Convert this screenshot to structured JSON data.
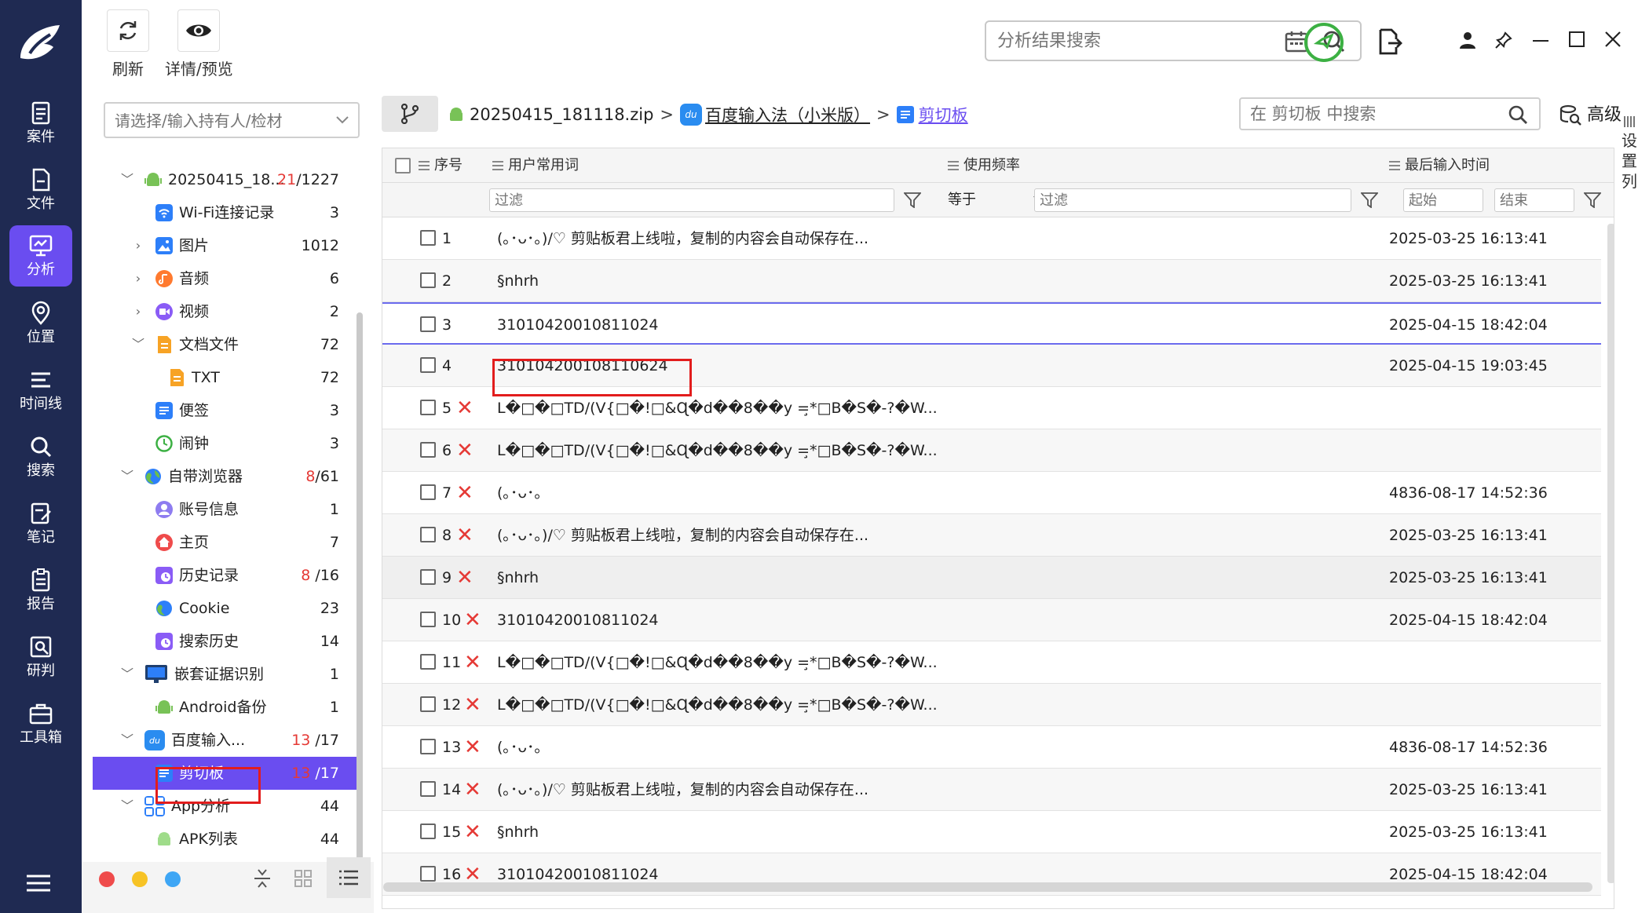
{
  "nav": {
    "items": [
      {
        "label": "案件",
        "icon": "case-icon"
      },
      {
        "label": "文件",
        "icon": "file-icon"
      },
      {
        "label": "分析",
        "icon": "analysis-icon",
        "active": true
      },
      {
        "label": "位置",
        "icon": "location-icon"
      },
      {
        "label": "时间线",
        "icon": "timeline-icon"
      },
      {
        "label": "搜索",
        "icon": "search-icon"
      },
      {
        "label": "笔记",
        "icon": "note-icon"
      },
      {
        "label": "报告",
        "icon": "report-icon"
      },
      {
        "label": "研判",
        "icon": "judge-icon"
      },
      {
        "label": "工具箱",
        "icon": "toolbox-icon"
      }
    ]
  },
  "toolbar": {
    "refresh_label": "刷新",
    "preview_label": "详情/预览",
    "search_placeholder": "分析结果搜索"
  },
  "tree": {
    "owner_placeholder": "请选择/输入持有人/检材",
    "rows": [
      {
        "label": "20250415_18...",
        "count_red": "21",
        "count": "/1227"
      },
      {
        "label": "Wi-Fi连接记录",
        "count_red": "",
        "count": "3"
      },
      {
        "label": "图片",
        "count_red": "",
        "count": "1012"
      },
      {
        "label": "音频",
        "count_red": "",
        "count": "6"
      },
      {
        "label": "视频",
        "count_red": "",
        "count": "2"
      },
      {
        "label": "文档文件",
        "count_red": "",
        "count": "72"
      },
      {
        "label": "TXT",
        "count_red": "",
        "count": "72"
      },
      {
        "label": "便签",
        "count_red": "",
        "count": "3"
      },
      {
        "label": "闹钟",
        "count_red": "",
        "count": "3"
      },
      {
        "label": "自带浏览器",
        "count_red": "8",
        "count": "/61"
      },
      {
        "label": "账号信息",
        "count_red": "",
        "count": "1"
      },
      {
        "label": "主页",
        "count_red": "",
        "count": "7"
      },
      {
        "label": "历史记录",
        "count_red": "8",
        "count": " /16"
      },
      {
        "label": "Cookie",
        "count_red": "",
        "count": "23"
      },
      {
        "label": "搜索历史",
        "count_red": "",
        "count": "14"
      },
      {
        "label": "嵌套证据识别",
        "count_red": "",
        "count": "1"
      },
      {
        "label": "Android备份",
        "count_red": "",
        "count": "1"
      },
      {
        "label": "百度输入...",
        "count_red": "13",
        "count": " /17"
      },
      {
        "label": "剪切板",
        "count_red": "13",
        "count": " /17"
      },
      {
        "label": "App分析",
        "count_red": "",
        "count": "44"
      },
      {
        "label": "APK列表",
        "count_red": "",
        "count": "44"
      }
    ]
  },
  "breadcrumb": {
    "zip": "20250415_181118.zip",
    "app": "百度输入法（小米版）",
    "current": "剪切板",
    "sep": ">"
  },
  "tab_search": {
    "placeholder": "在 剪切板 中搜索"
  },
  "advanced_label": "高级",
  "settings_col_label": "设置列",
  "grid": {
    "headers": {
      "index": "序号",
      "word": "用户常用词",
      "freq": "使用频率",
      "time": "最后输入时间"
    },
    "filter": {
      "placeholder": "过滤",
      "freq_op": "等于",
      "start": "起始",
      "end": "结束"
    },
    "rows": [
      {
        "n": "1",
        "del": false,
        "word": "(｡･ᴗ･｡)/♡ 剪贴板君上线啦，复制的内容会自动保存在...",
        "time": "2025-03-25 16:13:41"
      },
      {
        "n": "2",
        "del": false,
        "word": "§nhrh",
        "time": "2025-03-25 16:13:41"
      },
      {
        "n": "3",
        "del": false,
        "word": "31010420010811024",
        "time": "2025-04-15 18:42:04"
      },
      {
        "n": "4",
        "del": false,
        "word": "310104200108110624",
        "time": "2025-04-15 19:03:45"
      },
      {
        "n": "5",
        "del": true,
        "word": "L�□�□TD/(V{□�!□&Ɋ�d��8��y =̧*□B�S�-?�W...",
        "time": ""
      },
      {
        "n": "6",
        "del": true,
        "word": "L�□�□TD/(V{□�!□&Ɋ�d��8��y =̧*□B�S�-?�W...",
        "time": ""
      },
      {
        "n": "7",
        "del": true,
        "word": "(｡･ᴗ･｡",
        "time": "4836-08-17 14:52:36"
      },
      {
        "n": "8",
        "del": true,
        "word": "(｡･ᴗ･｡)/♡ 剪贴板君上线啦，复制的内容会自动保存在...",
        "time": "2025-03-25 16:13:41"
      },
      {
        "n": "9",
        "del": true,
        "word": "§nhrh",
        "time": "2025-03-25 16:13:41"
      },
      {
        "n": "10",
        "del": true,
        "word": "31010420010811024",
        "time": "2025-04-15 18:42:04"
      },
      {
        "n": "11",
        "del": true,
        "word": "L�□�□TD/(V{□�!□&Ɋ�d��8��y =̧*□B�S�-?�W...",
        "time": ""
      },
      {
        "n": "12",
        "del": true,
        "word": "L�□�□TD/(V{□�!□&Ɋ�d��8��y =̧*□B�S�-?�W...",
        "time": ""
      },
      {
        "n": "13",
        "del": true,
        "word": "(｡･ᴗ･｡",
        "time": "4836-08-17 14:52:36"
      },
      {
        "n": "14",
        "del": true,
        "word": "(｡･ᴗ･｡)/♡ 剪贴板君上线啦，复制的内容会自动保存在...",
        "time": "2025-03-25 16:13:41"
      },
      {
        "n": "15",
        "del": true,
        "word": "§nhrh",
        "time": "2025-03-25 16:13:41"
      },
      {
        "n": "16",
        "del": true,
        "word": "31010420010811024",
        "time": "2025-04-15 18:42:04"
      }
    ]
  },
  "colors": {
    "nav_bg": "#1f2a52",
    "accent": "#6a4df0",
    "deleted": "#e53935",
    "highlight_box": "#e21d1d"
  }
}
